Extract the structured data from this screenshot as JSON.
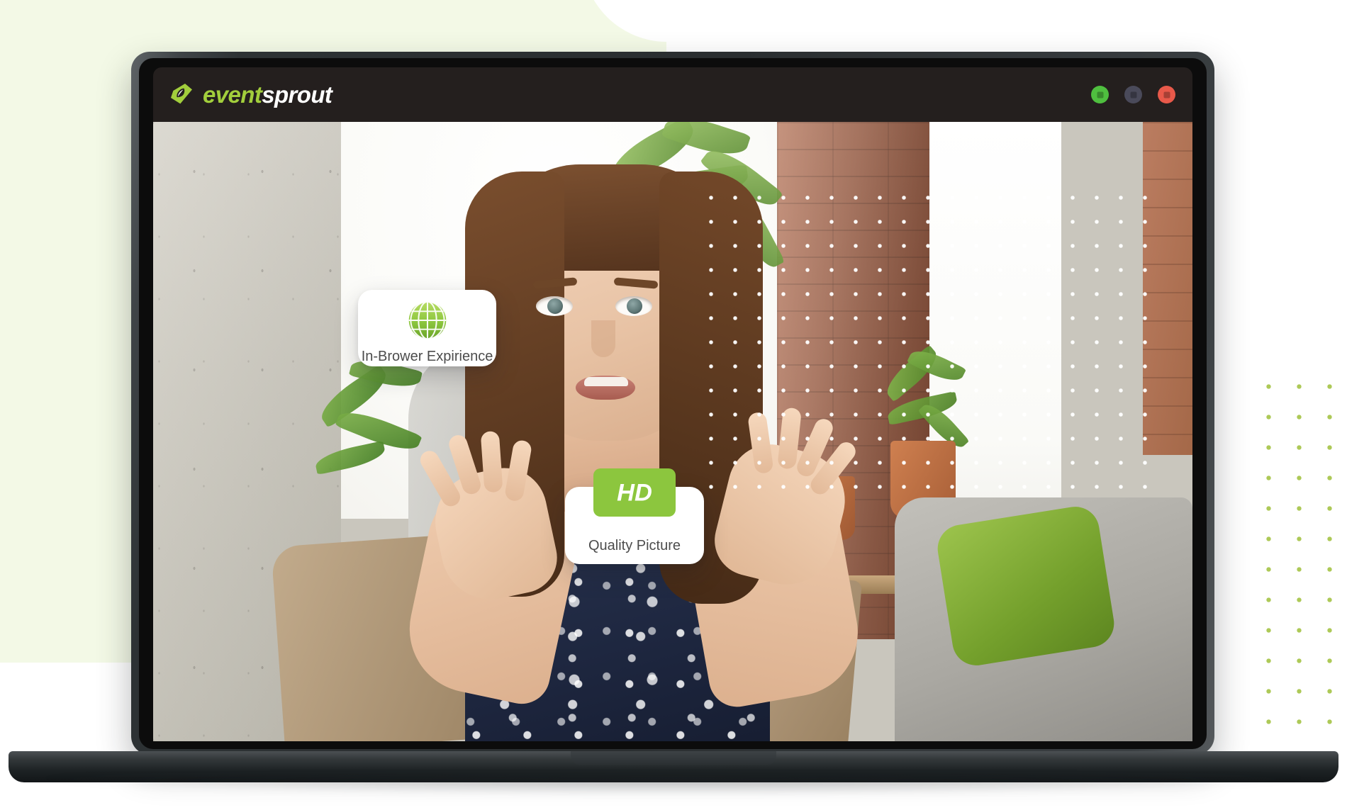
{
  "page": {
    "title": "EventSprout in-browser streaming laptop mockup",
    "background_color": "#ffffff",
    "accent_green": "#8cc63e",
    "blob_color": "#f3f9e6",
    "dot_pattern_color": "#a9c64e"
  },
  "browser_window": {
    "brand": {
      "icon": "ticket-leaf-logo-icon",
      "name_part_1": "event",
      "name_part_2": "sprout",
      "color_primary": "#a2ce3c",
      "color_secondary": "#ffffff"
    },
    "titlebar_color": "#241f1e",
    "window_controls": [
      {
        "name": "minimize",
        "color": "#4fbf3f"
      },
      {
        "name": "maximize",
        "color": "#4a4a5a"
      },
      {
        "name": "close",
        "color": "#e8594a"
      }
    ]
  },
  "video": {
    "alt": "Woman speaking on a video call in a loft room with brick wall and plants",
    "dot_overlay_color": "#ffffff"
  },
  "feature_cards": [
    {
      "id": "in-browser-experience",
      "icon": "globe-icon",
      "label": "In-Brower Expirience"
    },
    {
      "id": "quality-picture",
      "icon": "hd-badge-icon",
      "badge_text": "HD",
      "badge_color": "#8cc63e",
      "label": "Quality Picture"
    }
  ]
}
